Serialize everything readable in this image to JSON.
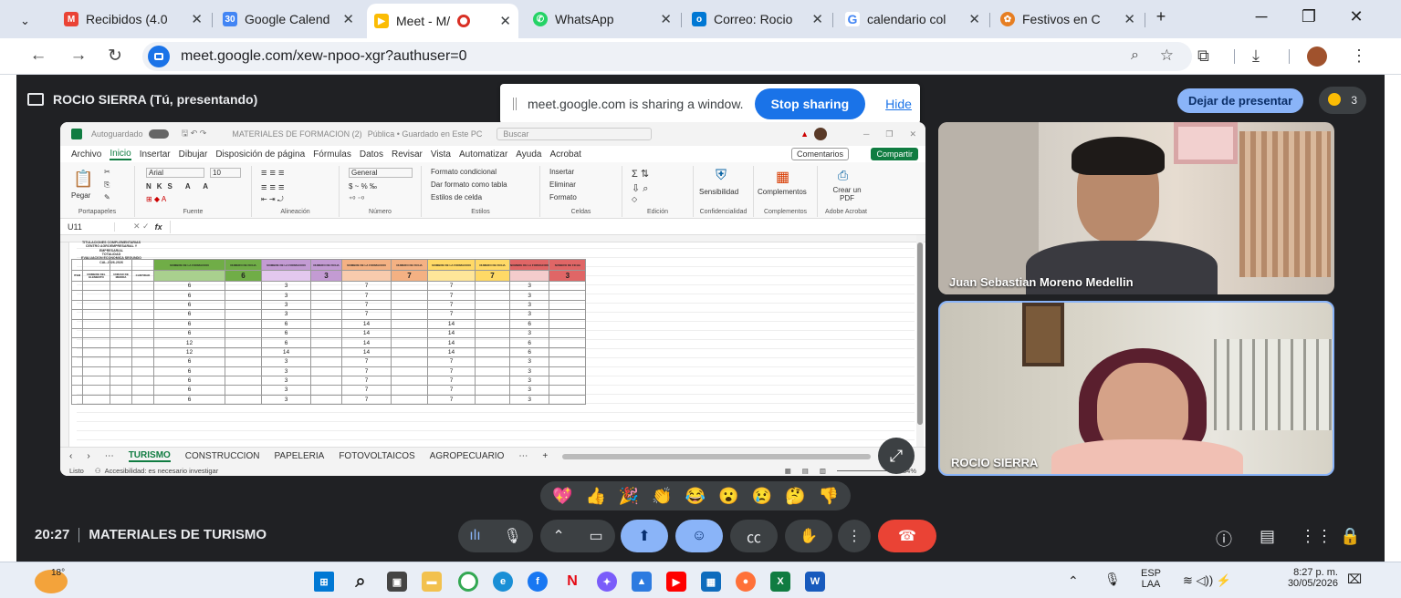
{
  "tabs": [
    {
      "label": "Recibidos (4.0",
      "icon": "gmail-icon",
      "color": "#ea4335"
    },
    {
      "label": "Google Calend",
      "icon": "calendar-icon",
      "color": "#4285f4"
    },
    {
      "label": "Meet - M/",
      "icon": "meet-icon",
      "color": "#fbbc04"
    },
    {
      "label": "WhatsApp",
      "icon": "whatsapp-icon",
      "color": "#25d366"
    },
    {
      "label": "Correo: Rocio",
      "icon": "outlook-icon",
      "color": "#0078d4"
    },
    {
      "label": "calendario col",
      "icon": "google-icon",
      "color": "#4285f4"
    },
    {
      "label": "Festivos en C",
      "icon": "festivos-icon",
      "color": "#e67e22"
    }
  ],
  "address": {
    "url": "meet.google.com/xew-npoo-xgr?authuser=0"
  },
  "meet": {
    "presenter_label": "ROCIO SIERRA (Tú, presentando)",
    "share_message": "meet.google.com is sharing a window.",
    "stop_sharing": "Stop sharing",
    "hide": "Hide",
    "stop_presenting": "Dejar de presentar",
    "participants_count": "3",
    "time": "20:27",
    "meeting_name": "MATERIALES DE TURISMO",
    "expand_icon": "expand-icon",
    "reactions": [
      "💖",
      "👍",
      "🎉",
      "👏",
      "😂",
      "😮",
      "😢",
      "🤔",
      "👎"
    ]
  },
  "participants": [
    {
      "name": "Juan Sebastian Moreno Medellin"
    },
    {
      "name": "ROCIO SIERRA"
    }
  ],
  "excel": {
    "title": "MATERIALES DE FORMACION (2)",
    "title_status": "Pública • Guardado en Este PC",
    "autosave": "Autoguardado",
    "search": "Buscar",
    "menu": [
      "Archivo",
      "Inicio",
      "Insertar",
      "Dibujar",
      "Disposición de página",
      "Fórmulas",
      "Datos",
      "Revisar",
      "Vista",
      "Automatizar",
      "Ayuda",
      "Acrobat"
    ],
    "active_menu": "Inicio",
    "comments": "Comentarios",
    "share": "Compartir",
    "groups": [
      "Portapapeles",
      "Fuente",
      "Alineación",
      "Número",
      "Estilos",
      "Celdas",
      "Edición",
      "Confidencialidad",
      "Complementos",
      "Adobe Acrobat"
    ],
    "font_name": "Arial",
    "font_size": "10",
    "number_format": "General",
    "styles_items": [
      "Formato condicional",
      "Dar formato como tabla",
      "Estilos de celda"
    ],
    "cells_items": [
      "Insertar",
      "Eliminar",
      "Formato"
    ],
    "paste": "Pegar",
    "sensitivity": "Sensibilidad",
    "addins": "Complementos",
    "create_pdf": "Crear un PDF",
    "cell_ref": "U11",
    "fx": "fx",
    "sheet_title": [
      "TITULACIONES COMPLEMENTARIAS",
      "CENTRO AGROEMPRESARIAL Y EMPRESARIAL",
      "TOTALIDAD",
      "EVALUACION ECONOMICA SEGUNDO CAL-2026-2026"
    ],
    "headers": [
      "ITEM",
      "NOMBRE DEL ELEMENTO",
      "UNIDAD DE MEDIDA",
      "CANTIDAD",
      "NOMBRE DE LA FORMACION",
      "NUMERO DE FICHA",
      "NOMBRE DE LA FORMACION",
      "NUMERO DE FICHA",
      "NOMBRE DE LA FORMACION",
      "NUMERO DE FICHA",
      "NOMBRE DE LA FORMACION",
      "NUMERO DE FICHA",
      "NOMBRE DE LA FORMACION",
      "NUMERO DE FICHA"
    ],
    "header_values": [
      "6",
      "3",
      "7",
      "7",
      "3"
    ],
    "rows": [
      {
        "a": "6",
        "b": "3",
        "c": "7",
        "d": "7",
        "e": "3"
      },
      {
        "a": "6",
        "b": "3",
        "c": "7",
        "d": "7",
        "e": "3"
      },
      {
        "a": "6",
        "b": "3",
        "c": "7",
        "d": "7",
        "e": "3"
      },
      {
        "a": "6",
        "b": "3",
        "c": "7",
        "d": "7",
        "e": "3"
      },
      {
        "a": "6",
        "b": "6",
        "c": "14",
        "d": "14",
        "e": "6"
      },
      {
        "a": "6",
        "b": "6",
        "c": "14",
        "d": "14",
        "e": "3"
      },
      {
        "a": "12",
        "b": "6",
        "c": "14",
        "d": "14",
        "e": "6"
      },
      {
        "a": "12",
        "b": "14",
        "c": "14",
        "d": "14",
        "e": "6"
      },
      {
        "a": "6",
        "b": "3",
        "c": "7",
        "d": "7",
        "e": "3"
      },
      {
        "a": "6",
        "b": "3",
        "c": "7",
        "d": "7",
        "e": "3"
      },
      {
        "a": "6",
        "b": "3",
        "c": "7",
        "d": "7",
        "e": "3"
      },
      {
        "a": "6",
        "b": "3",
        "c": "7",
        "d": "7",
        "e": "3"
      },
      {
        "a": "6",
        "b": "3",
        "c": "7",
        "d": "7",
        "e": "3"
      }
    ],
    "sheets": [
      "TURISMO",
      "CONSTRUCCION",
      "PAPELERIA",
      "FOTOVOLTAICOS",
      "AGROPECUARIO"
    ],
    "active_sheet": "TURISMO",
    "status_ready": "Listo",
    "status_access": "Accesibilidad: es necesario investigar",
    "zoom": "34%"
  },
  "taskbar": {
    "weather": "18°",
    "lang": "ESP",
    "lang2": "LAA",
    "time": "8:27 p. m.",
    "date": "30/05/2026"
  }
}
